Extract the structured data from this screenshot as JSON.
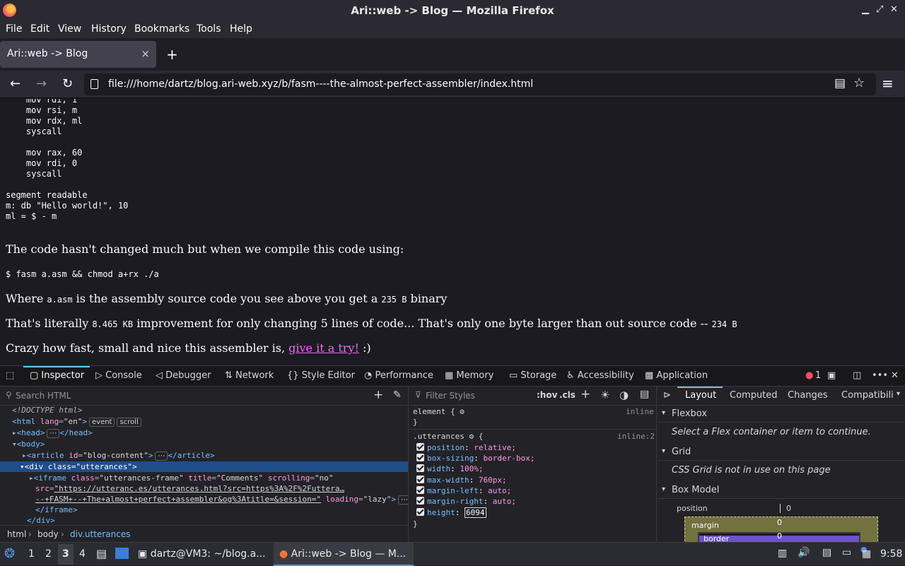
{
  "window": {
    "title": "Ari::web -> Blog — Mozilla Firefox",
    "minimize_icon": "minimize-icon",
    "maximize_icon": "maximize-icon",
    "close_icon": "close-icon"
  },
  "menu": [
    "File",
    "Edit",
    "View",
    "History",
    "Bookmarks",
    "Tools",
    "Help"
  ],
  "tab": {
    "title": "Ari::web -> Blog",
    "close": "×",
    "new_tab": "+"
  },
  "nav": {
    "back": "←",
    "forward": "→",
    "reload": "↻",
    "url": "file:///home/dartz/blog.ari-web.xyz/b/fasm----the-almost-perfect-assembler/index.html",
    "reader": "▤",
    "bookmark": "☆",
    "menu": "≡"
  },
  "page": {
    "code_block": "    mov rdi, 1\n    mov rsi, m\n    mov rdx, ml\n    syscall\n\n    mov rax, 60\n    mov rdi, 0\n    syscall\n\nsegment readable\nm: db \"Hello world!\", 10\nml = $ - m",
    "para1": "The code hasn't changed much but when we compile this code using:",
    "cmd": "$ fasm a.asm && chmod a+rx ./a",
    "para2_a": "Where ",
    "para2_code1": "a.asm",
    "para2_b": " is the assembly source code you see above you get a ",
    "para2_code2": "235 B",
    "para2_c": " binary",
    "para3_a": "That's literally ",
    "para3_code1": "8.465 KB",
    "para3_b": " improvement for only changing 5 lines of code... That's only one byte larger than out source code -- ",
    "para3_code2": "234 B",
    "para4_a": "Crazy how fast, small and nice this assembler is, ",
    "para4_link": "give it a try!",
    "para4_b": " :)"
  },
  "devtools": {
    "tabs": [
      "Inspector",
      "Console",
      "Debugger",
      "Network",
      "Style Editor",
      "Performance",
      "Memory",
      "Storage",
      "Accessibility",
      "Application"
    ],
    "error_count": "1",
    "search_html_placeholder": "Search HTML",
    "filter_styles_placeholder": "Filter Styles",
    "hov": ":hov",
    "cls": ".cls",
    "tree": {
      "doctype": "<!DOCTYPE html>",
      "html_open": "<html",
      "html_attr": "lang",
      "html_val": "\"en\"",
      "badge_event": "event",
      "badge_scroll": "scroll",
      "head": "<head>",
      "head_close": "</head>",
      "body": "<body>",
      "article_open": "<article",
      "article_attr": "id",
      "article_val": "\"blog-content\"",
      "article_close": "</article>",
      "div_open": "<div",
      "div_attr": "class",
      "div_val": "\"utterances\"",
      "iframe_open": "<iframe",
      "iframe_class_attr": "class",
      "iframe_class_val": "\"utterances-frame\"",
      "iframe_title_attr": "title",
      "iframe_title_val": "\"Comments\"",
      "iframe_scroll_attr": "scrolling",
      "iframe_scroll_val": "\"no\"",
      "iframe_src_attr": "src",
      "iframe_src_1": "\"https://utteranc.es/utterances.html?src=https%3A%2F%2Futtera…",
      "iframe_src_2": "--+FASM+--+The+almost+perfect+assembler&og%3Atitle=&session=\"",
      "iframe_loading_attr": "loading",
      "iframe_loading_val": "\"lazy\"",
      "iframe_close": "</iframe>",
      "div_close": "</div>"
    },
    "breadcrumbs": [
      "html",
      "body",
      "div.utterances"
    ],
    "rules": {
      "element_selector": "element {",
      "element_source": "inline",
      "close_brace": "}",
      "utt_selector": ".utterances",
      "utt_source": "inline:2",
      "open_brace": "{",
      "props": [
        {
          "name": "position",
          "value": "relative;"
        },
        {
          "name": "box-sizing",
          "value": "border-box;"
        },
        {
          "name": "width",
          "value": "100%;"
        },
        {
          "name": "max-width",
          "value": "760px;"
        },
        {
          "name": "margin-left",
          "value": "auto;"
        },
        {
          "name": "margin-right",
          "value": "auto;"
        },
        {
          "name": "height",
          "value": "6094"
        }
      ]
    },
    "layout_tabs": [
      "Layout",
      "Computed",
      "Changes",
      "Compatibili"
    ],
    "flexbox": "Flexbox",
    "flexbox_msg": "Select a Flex container or item to continue.",
    "grid": "Grid",
    "grid_msg": "CSS Grid is not in use on this page",
    "box_model": "Box Model",
    "bm_position": "position",
    "bm_position_val": "0",
    "bm_margin": "margin",
    "bm_margin_val": "0",
    "bm_border": "border",
    "bm_border_val": "0"
  },
  "taskbar": {
    "workspaces": [
      "1",
      "2",
      "3",
      "4"
    ],
    "terminal_task": "dartz@VM3: ~/blog.a...",
    "firefox_task": "Ari::web -> Blog — M...",
    "clock": "9:58"
  },
  "colors": {
    "accent": "#75bfff",
    "link": "#e86ef2",
    "selection": "#204e8a",
    "error": "#ff4f5e"
  }
}
